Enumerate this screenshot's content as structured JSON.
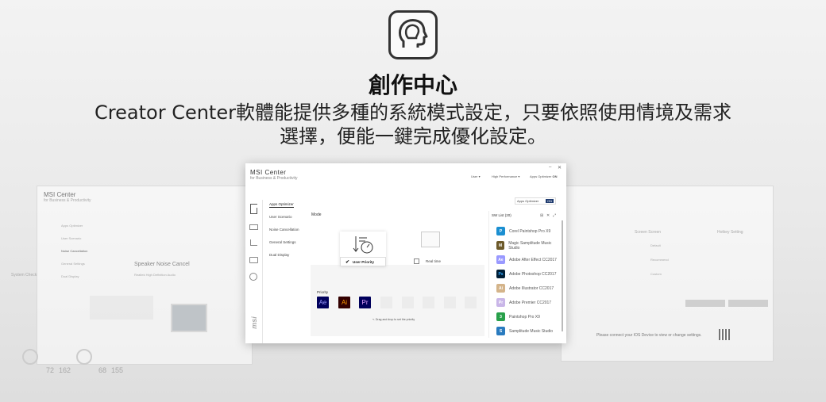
{
  "hero": {
    "title": "創作中心",
    "subtitle_line1": "Creator Center軟體能提供多種的系統模式設定，只要依照使用情境及需求",
    "subtitle_line2": "選擇，便能一鍵完成優化設定。",
    "icon": "creator-head-icon"
  },
  "main_window": {
    "app_name": "MSI Center",
    "app_subtitle": "for Business & Productivity",
    "titlebar": {
      "user": "User",
      "performance": "High Performance",
      "apps_optimizer": "Apps Optimizer",
      "apps_optimizer_state": "ON"
    },
    "sidebar_icons": [
      "home-icon",
      "monitor-icon",
      "chart-icon",
      "toolbox-icon",
      "settings-icon"
    ],
    "logo_text": "msi",
    "nav": {
      "items": [
        "Apps Optimizer",
        "User Scenario",
        "Noise Cancellation",
        "General Settings",
        "Dual Display"
      ]
    },
    "content": {
      "mode_label": "Mode",
      "toggle_label": "Apps Optimizer",
      "toggle_state": "ON",
      "user_priority": "User Priority",
      "real_time": "Real time",
      "priority_label": "Priority",
      "priority_apps": [
        "Ae",
        "Ai",
        "Pr"
      ],
      "drag_hint": "Drag and drop to set the priority"
    },
    "sw_list": {
      "title": "SW List (20)",
      "items": [
        {
          "name": "Corel Paintshop Pro X9",
          "icon": "P",
          "color": "#1b8fd1"
        },
        {
          "name": "Magic Samplitude Music Studio",
          "icon": "M",
          "color": "#6d5a2a"
        },
        {
          "name": "Adobe After Effect CC2017",
          "icon": "Ae",
          "color": "#9999ff"
        },
        {
          "name": "Adobe Photoshop CC2017",
          "icon": "Ps",
          "color": "#001e36"
        },
        {
          "name": "Adobe Illustrator CC2017",
          "icon": "Ai",
          "color": "#d4b48a"
        },
        {
          "name": "Adobe Premier CC2017",
          "icon": "Pr",
          "color": "#c9b6e8"
        },
        {
          "name": "Paintshop Pro X9",
          "icon": "3",
          "color": "#28a04a"
        },
        {
          "name": "Samplitude Music Studio",
          "icon": "S",
          "color": "#2a7bbf"
        }
      ]
    }
  },
  "left_ghost": {
    "app_name": "MSI Center",
    "app_subtitle": "for Business & Productivity",
    "nav": [
      "Apps Optimizer",
      "User Scenario",
      "Noise Cancellation",
      "General Settings",
      "Dual Display"
    ],
    "section": "Speaker Noise Cancel",
    "device": "Realtek High Definition Audio",
    "system_check": "System Check",
    "stat1": "72",
    "stat2": "68",
    "stat_extra1": "162",
    "stat_extra2": "155"
  },
  "right_ghost": {
    "screen_screen": "Screen Screen",
    "hotkey_setting": "Hotkey Setting",
    "options": [
      "Default",
      "Recommend",
      "Custom"
    ],
    "ios_message": "Please connect your IOS Device to view or change settings."
  }
}
